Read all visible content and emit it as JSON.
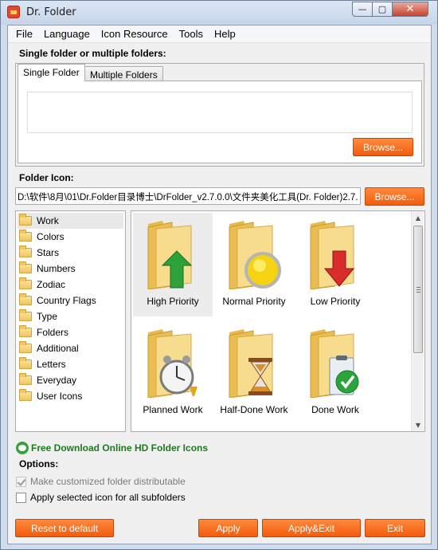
{
  "window": {
    "title": "Dr. Folder",
    "min_glyph": "—",
    "max_glyph": "▢",
    "close_glyph": "✕"
  },
  "menu": [
    "File",
    "Language",
    "Icon Resource",
    "Tools",
    "Help"
  ],
  "single_or_multi_label": "Single folder or multiple folders:",
  "tabs": [
    {
      "label": "Single Folder",
      "active": true
    },
    {
      "label": "Multiple Folders",
      "active": false
    }
  ],
  "folders_browse_label": "Browse...",
  "folder_icon_label": "Folder Icon:",
  "icon_path": "D:\\软件\\8月\\01\\Dr.Folder目录博士\\DrFolder_v2.7.0.0\\文件夹美化工具(Dr. Folder)2.7.",
  "icon_browse_label": "Browse...",
  "categories": [
    "Work",
    "Colors",
    "Stars",
    "Numbers",
    "Zodiac",
    "Country Flags",
    "Type",
    "Folders",
    "Additional",
    "Letters",
    "Everyday",
    "User Icons"
  ],
  "selected_category": "Work",
  "icons": [
    {
      "label": "High Priority",
      "icon": "up-arrow-icon",
      "selected": true
    },
    {
      "label": "Normal Priority",
      "icon": "circle-icon",
      "selected": false
    },
    {
      "label": "Low Priority",
      "icon": "down-arrow-icon",
      "selected": false
    },
    {
      "label": "Planned Work",
      "icon": "alarm-clock-icon",
      "selected": false
    },
    {
      "label": "Half-Done Work",
      "icon": "hourglass-icon",
      "selected": false
    },
    {
      "label": "Done Work",
      "icon": "clipboard-check-icon",
      "selected": false
    }
  ],
  "download_link": "Free Download Online HD Folder Icons",
  "options_label": "Options:",
  "options": [
    {
      "label": "Make customized folder distributable",
      "checked": true,
      "disabled": true
    },
    {
      "label": "Apply selected icon for all subfolders",
      "checked": false,
      "disabled": false
    }
  ],
  "buttons": {
    "reset": "Reset to default",
    "apply": "Apply",
    "apply_exit": "Apply&Exit",
    "exit": "Exit"
  },
  "colors": {
    "accent_orange": "#f25c0c",
    "link_green": "#1d7a1d",
    "folder_yellow": "#efc663"
  }
}
